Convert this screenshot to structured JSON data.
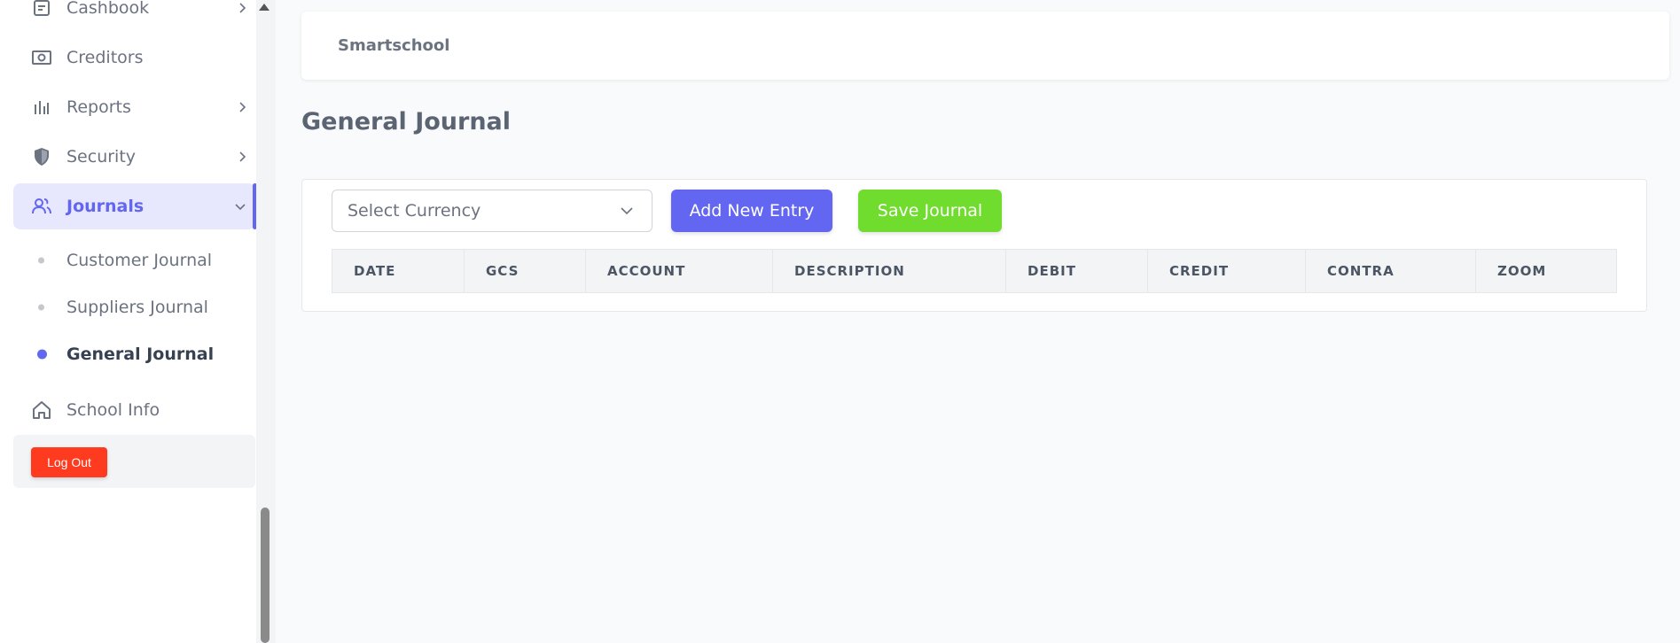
{
  "sidebar": {
    "items": [
      {
        "label": "Cashbook",
        "icon": "cashbook-icon"
      },
      {
        "label": "Creditors",
        "icon": "creditors-icon"
      },
      {
        "label": "Reports",
        "icon": "reports-icon"
      },
      {
        "label": "Security",
        "icon": "shield-icon"
      },
      {
        "label": "Journals",
        "icon": "users-icon"
      },
      {
        "label": "School Info",
        "icon": "home-icon"
      }
    ],
    "journals_sub": [
      {
        "label": "Customer Journal"
      },
      {
        "label": "Suppliers Journal"
      },
      {
        "label": "General Journal"
      }
    ],
    "logout_label": "Log Out"
  },
  "header": {
    "brand": "Smartschool"
  },
  "main": {
    "title": "General Journal",
    "currency_select": {
      "placeholder": "Select Currency"
    },
    "add_button": "Add New Entry",
    "save_button": "Save Journal",
    "table": {
      "columns": [
        "DATE",
        "GCS",
        "ACCOUNT",
        "DESCRIPTION",
        "DEBIT",
        "CREDIT",
        "CONTRA",
        "ZOOM"
      ],
      "rows": []
    }
  },
  "colors": {
    "accent": "#6366f1",
    "save": "#6fdc2e",
    "logout": "#ff3b1f"
  }
}
